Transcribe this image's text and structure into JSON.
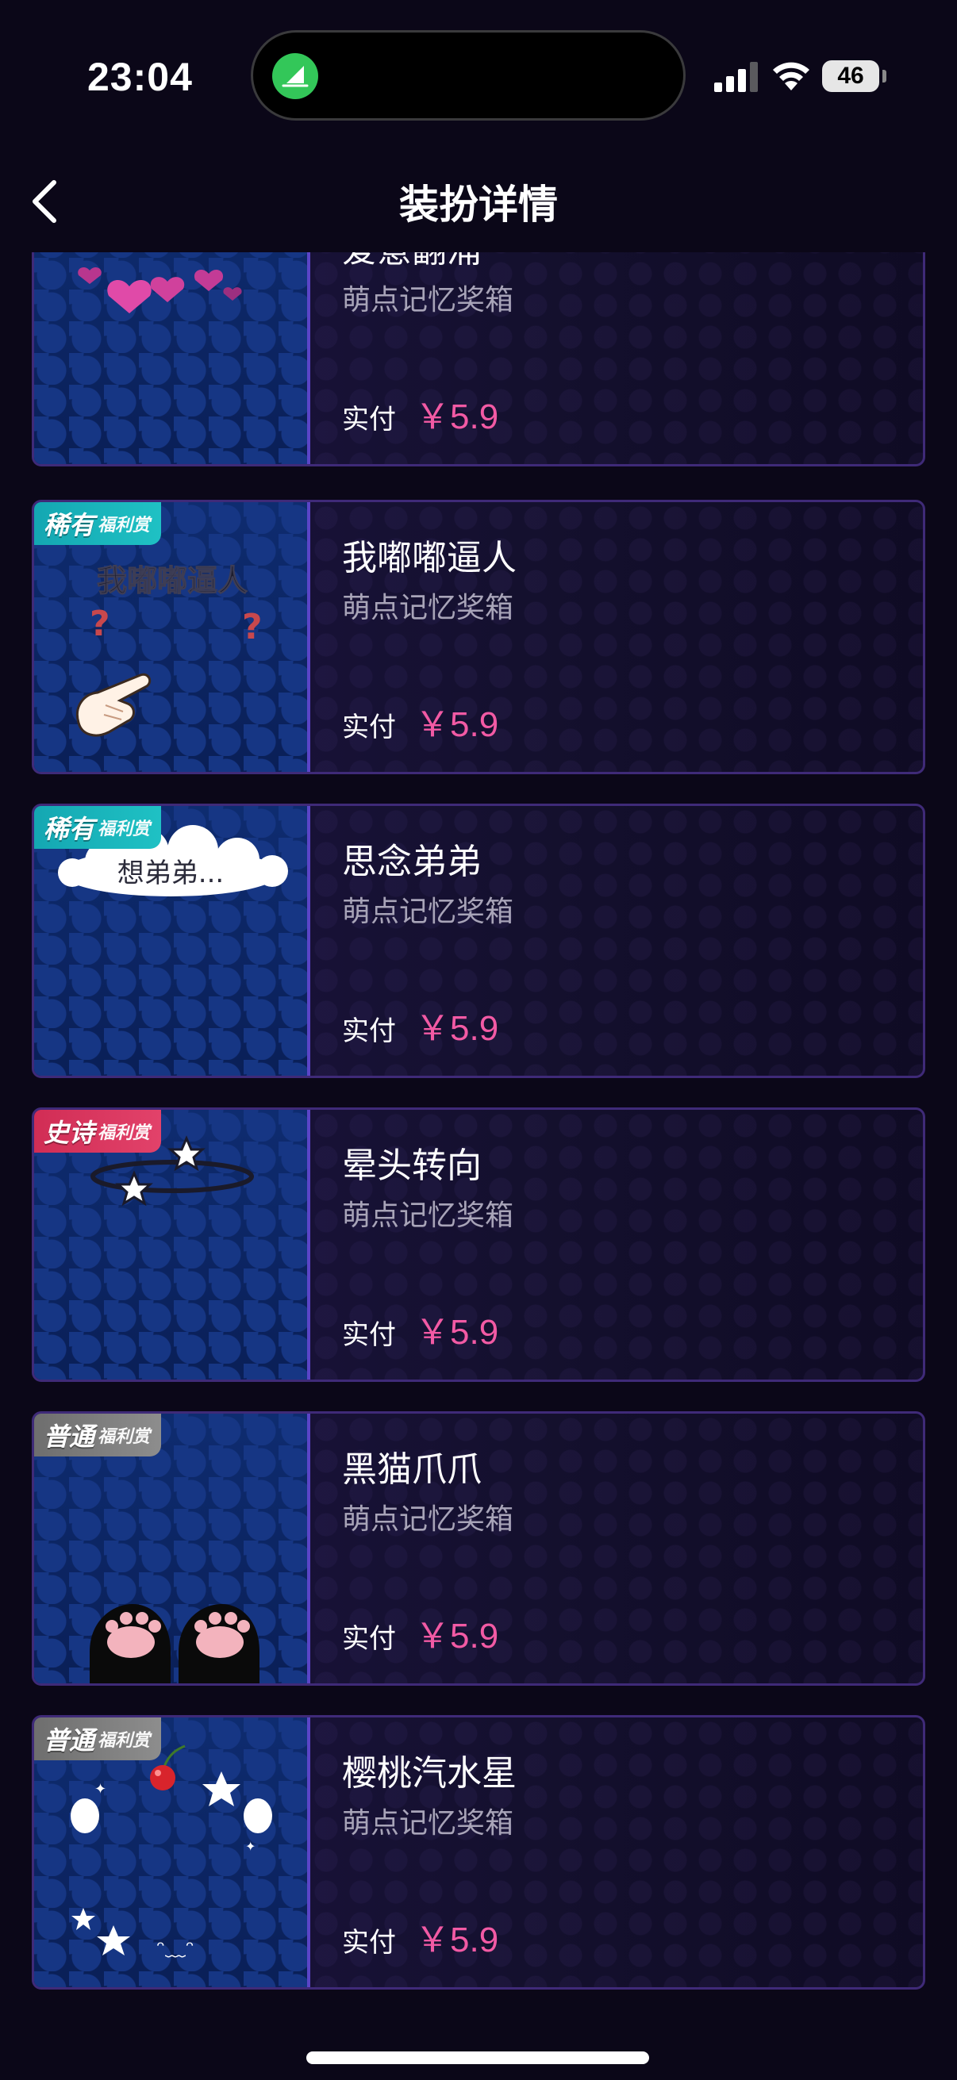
{
  "status_bar": {
    "time": "23:04",
    "battery": "46",
    "icons": [
      "app-activity-icon",
      "signal-icon",
      "wifi-icon",
      "battery-icon"
    ]
  },
  "nav": {
    "back_icon": "chevron-left-icon",
    "title": "装扮详情"
  },
  "colors": {
    "background": "#0b0718",
    "price": "#f25aa4",
    "rare_badge": "#1fc1c4",
    "epic_badge": "#e2426a",
    "common_badge": "#8d8d8d",
    "card_border": "#3f2a78"
  },
  "items": [
    {
      "name": "爱意翻涌",
      "source": "萌点记忆奖箱",
      "paid_label": "实付",
      "price": "￥5.9",
      "rarity": "",
      "welfare": "",
      "art": "hearts"
    },
    {
      "name": "我嘟嘟逼人",
      "source": "萌点记忆奖箱",
      "paid_label": "实付",
      "price": "￥5.9",
      "rarity": "稀有",
      "welfare": "福利赏",
      "art_text": "我嘟嘟逼人",
      "art": "pointing-hand"
    },
    {
      "name": "思念弟弟",
      "source": "萌点记忆奖箱",
      "paid_label": "实付",
      "price": "￥5.9",
      "rarity": "稀有",
      "welfare": "福利赏",
      "art_text": "想弟弟...",
      "art": "cloud"
    },
    {
      "name": "晕头转向",
      "source": "萌点记忆奖箱",
      "paid_label": "实付",
      "price": "￥5.9",
      "rarity": "史诗",
      "welfare": "福利赏",
      "art": "dizzy-stars"
    },
    {
      "name": "黑猫爪爪",
      "source": "萌点记忆奖箱",
      "paid_label": "实付",
      "price": "￥5.9",
      "rarity": "普通",
      "welfare": "福利赏",
      "art": "cat-paws"
    },
    {
      "name": "樱桃汽水星",
      "source": "萌点记忆奖箱",
      "paid_label": "实付",
      "price": "￥5.9",
      "rarity": "普通",
      "welfare": "福利赏",
      "art_text": "ᵔ﹏ᵔ",
      "art": "cherry-stars"
    }
  ]
}
